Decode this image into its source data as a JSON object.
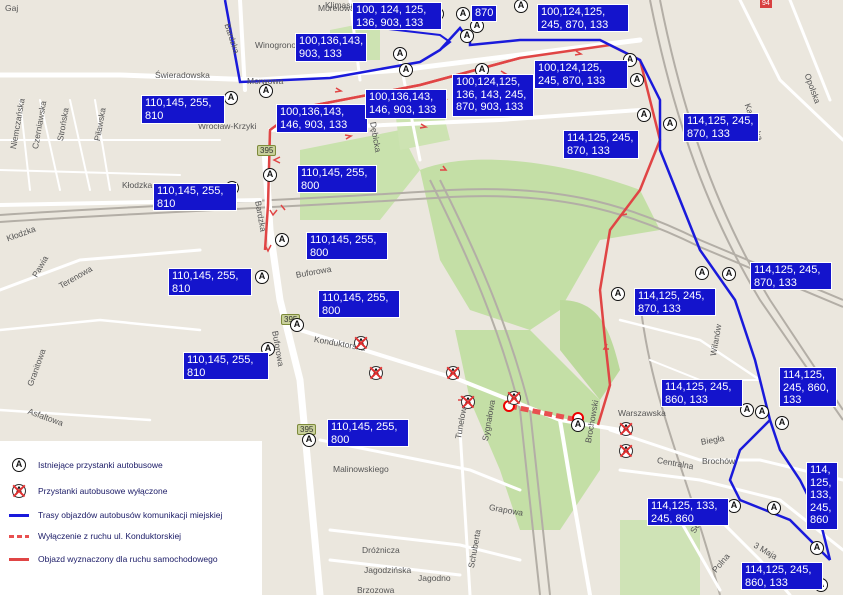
{
  "streets": [
    {
      "name": "Morelowa"
    },
    {
      "name": "Gaj"
    },
    {
      "name": "Bardzka"
    },
    {
      "name": "Winogronowa"
    },
    {
      "name": "Świeradowska"
    },
    {
      "name": "Morwowa"
    },
    {
      "name": "Klimasa"
    },
    {
      "name": "Wrocław-Krzyki"
    },
    {
      "name": "Niemczańska"
    },
    {
      "name": "Czerniawska"
    },
    {
      "name": "Strońska"
    },
    {
      "name": "Piławska"
    },
    {
      "name": "Kłodzka"
    },
    {
      "name": "Kłodzka"
    },
    {
      "name": "Bardzka"
    },
    {
      "name": "Buforowa"
    },
    {
      "name": "Buforowa"
    },
    {
      "name": "Konduktorska"
    },
    {
      "name": "Pawia"
    },
    {
      "name": "Terenowa"
    },
    {
      "name": "Granitowa"
    },
    {
      "name": "Asfaltowa"
    },
    {
      "name": "Tunelowa"
    },
    {
      "name": "Sygnałowa"
    },
    {
      "name": "Malinowskiego"
    },
    {
      "name": "Grapowa"
    },
    {
      "name": "Dróżnicza"
    },
    {
      "name": "Jagodzińska"
    },
    {
      "name": "Brzozowa"
    },
    {
      "name": "Jagodno"
    },
    {
      "name": "Schuberta"
    },
    {
      "name": "Brochowski"
    },
    {
      "name": "Warszawska"
    },
    {
      "name": "Biegła"
    },
    {
      "name": "Centralna"
    },
    {
      "name": "Brochów"
    },
    {
      "name": "Wilanów"
    },
    {
      "name": "Semafora"
    },
    {
      "name": "3 Maja"
    },
    {
      "name": "Polna"
    },
    {
      "name": "Opolska"
    },
    {
      "name": "Katowicka"
    },
    {
      "name": "Dębicka"
    },
    {
      "name": "Pawia"
    }
  ],
  "road_numbers": [
    {
      "text": "395"
    },
    {
      "text": "395"
    },
    {
      "text": "395"
    },
    {
      "text": "94"
    }
  ],
  "route_labels": [
    {
      "text": "100, 124, 125,\n136, 903, 133"
    },
    {
      "text": "870"
    },
    {
      "text": "100,124,125,\n245, 870, 133"
    },
    {
      "text": "100,136,143,\n903, 133"
    },
    {
      "text": "100,124,125,\n245, 870, 133"
    },
    {
      "text": "110,145, 255,\n810"
    },
    {
      "text": "100,136,143,\n146, 903, 133"
    },
    {
      "text": "100,136,143,\n146, 903, 133"
    },
    {
      "text": "100,124,125,\n136, 143, 245,\n870, 903, 133"
    },
    {
      "text": "114,125, 245,\n870, 133"
    },
    {
      "text": "114,125, 245,\n870, 133"
    },
    {
      "text": "110,145, 255,\n800"
    },
    {
      "text": "110,145, 255,\n810"
    },
    {
      "text": "110,145, 255,\n800"
    },
    {
      "text": "114,125, 245,\n870, 133"
    },
    {
      "text": "110,145, 255,\n810"
    },
    {
      "text": "114,125, 245,\n870, 133"
    },
    {
      "text": "110,145, 255,\n800"
    },
    {
      "text": "110,145, 255,\n810"
    },
    {
      "text": "114,125, 245,\n860, 133"
    },
    {
      "text": "114,125,\n245, 860,\n133"
    },
    {
      "text": "110,145, 255,\n800"
    },
    {
      "text": "114,\n125,\n133,\n245,\n860"
    },
    {
      "text": "114,125, 133,\n245, 860"
    },
    {
      "text": "114,125, 245,\n860, 133"
    }
  ],
  "stop_glyph": "A",
  "legend": {
    "items": [
      {
        "label": "Istniejące przystanki autobusowe"
      },
      {
        "label": "Przystanki autobusowe wyłączone"
      },
      {
        "label": "Trasy objazdów autobusów komunikacji miejskiej"
      },
      {
        "label": "Wyłączenie z ruchu ul. Konduktorskiej"
      },
      {
        "label": "Objazd wyznaczony dla ruchu samochodowego"
      }
    ]
  },
  "colors": {
    "bus_detour": "#1a1adb",
    "closure": "#e85050",
    "car_detour": "#e04545",
    "label_bg": "#1414cc",
    "park": "#b9d99a",
    "road": "#ffffff",
    "rail": "#b0aca5"
  }
}
